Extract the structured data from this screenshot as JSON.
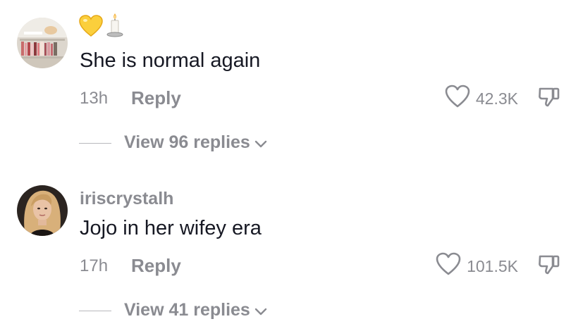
{
  "comments": [
    {
      "username": "",
      "name_emojis": [
        "yellow-heart",
        "candle"
      ],
      "text": "She is normal again",
      "time": "13h",
      "reply_label": "Reply",
      "likes": "42.3K",
      "view_replies": "View 96 replies"
    },
    {
      "username": "iriscrystalh",
      "text": "Jojo in her wifey era",
      "time": "17h",
      "reply_label": "Reply",
      "likes": "101.5K",
      "view_replies": "View 41 replies"
    }
  ],
  "colors": {
    "text": "#161823",
    "muted": "#8a8b91"
  }
}
